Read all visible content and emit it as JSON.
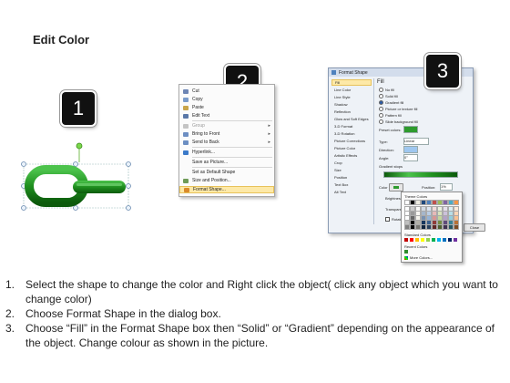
{
  "title": "Edit Color",
  "steps": [
    "1",
    "2",
    "3"
  ],
  "context_menu": {
    "items": [
      {
        "label": "Cut",
        "icon": "scissors-icon"
      },
      {
        "label": "Copy",
        "icon": "copy-icon"
      },
      {
        "label": "Paste",
        "icon": "paste-icon"
      },
      {
        "label": "Edit Text",
        "icon": "text-icon"
      },
      {
        "label": "Group",
        "icon": "group-icon",
        "submenu": true,
        "disabled": true
      },
      {
        "label": "Bring to Front",
        "icon": "bring-front-icon",
        "submenu": true
      },
      {
        "label": "Send to Back",
        "icon": "send-back-icon",
        "submenu": true
      },
      {
        "label": "Hyperlink...",
        "icon": "hyperlink-icon"
      },
      {
        "label": "Save as Picture...",
        "icon": ""
      },
      {
        "label": "Set as Default Shape",
        "icon": ""
      },
      {
        "label": "Size and Position...",
        "icon": "size-icon"
      },
      {
        "label": "Format Shape...",
        "icon": "format-shape-icon",
        "highlighted": true
      }
    ]
  },
  "dialog": {
    "title": "Format Shape",
    "categories": [
      "Fill",
      "Line Color",
      "Line Style",
      "Shadow",
      "Reflection",
      "Glow and Soft Edges",
      "3-D Format",
      "3-D Rotation",
      "Picture Corrections",
      "Picture Color",
      "Artistic Effects",
      "Crop",
      "Size",
      "Position",
      "Text Box",
      "Alt Text"
    ],
    "selected_category": "Fill",
    "section_title": "Fill",
    "fill_options": [
      "No fill",
      "Solid fill",
      "Gradient fill",
      "Picture or texture fill",
      "Pattern fill",
      "Slide background fill"
    ],
    "selected_fill": "Gradient fill",
    "preset_colors_label": "Preset colors:",
    "type_label": "Type:",
    "type_value": "Linear",
    "direction_label": "Direction:",
    "angle_label": "Angle:",
    "angle_value": "0°",
    "gradient_stops_label": "Gradient stops",
    "color_label": "Color",
    "position_label": "Position:",
    "position_value": "1%",
    "brightness_label": "Brightness",
    "transparency_label": "Transparen",
    "rotate_label": "Rotate",
    "close_label": "Close",
    "theme_colors_label": "Theme Colors",
    "standard_colors_label": "Standard Colors",
    "recent_colors_label": "Recent Colors",
    "more_colors_label": "More Colors...",
    "theme_colors": [
      "#ffffff",
      "#000000",
      "#eeece1",
      "#1f497d",
      "#4f81bd",
      "#c0504d",
      "#9bbb59",
      "#8064a2",
      "#4bacc6",
      "#f79646"
    ],
    "standard_colors": [
      "#c00000",
      "#ff0000",
      "#ffc000",
      "#ffff00",
      "#92d050",
      "#00b050",
      "#00b0f0",
      "#0070c0",
      "#002060",
      "#7030a0"
    ],
    "recent_colors": [
      "#2e8b2e"
    ]
  },
  "instructions": [
    {
      "num": "1.",
      "text": "Select the shape to change the color and Right click the object( click any object which you want to change color)"
    },
    {
      "num": "2.",
      "text": "Choose Format Shape in the dialog box."
    },
    {
      "num": "3.",
      "text": "Choose “Fill” in the Format Shape box then “Solid” or “Gradient” depending on the appearance of the object. Change colour as shown in the picture."
    }
  ],
  "colors": {
    "accent_green": "#2e9b2e",
    "menu_highlight": "#fde9a8",
    "dialog_bg": "#eef2f7"
  }
}
